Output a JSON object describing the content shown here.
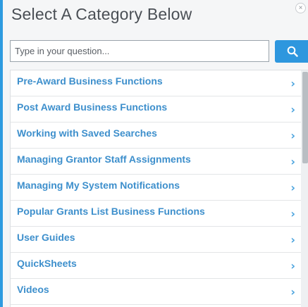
{
  "dialog": {
    "title": "Select A Category Below",
    "close_label": "×"
  },
  "search": {
    "placeholder": "Type in your question..."
  },
  "categories": [
    {
      "label": "Pre-Award Business Functions"
    },
    {
      "label": "Post Award Business Functions"
    },
    {
      "label": "Working with Saved Searches"
    },
    {
      "label": "Managing Grantor Staff Assignments"
    },
    {
      "label": "Managing My System Notifications"
    },
    {
      "label": "Popular Grants List Business Functions"
    },
    {
      "label": "User Guides"
    },
    {
      "label": "QuickSheets"
    },
    {
      "label": "Videos"
    }
  ],
  "icons": {
    "search": "search-icon",
    "chevron": "chevron-right-icon",
    "close": "close-icon"
  },
  "colors": {
    "accent": "#2e97de",
    "link": "#3d8fcc",
    "title": "#4a4f55"
  }
}
